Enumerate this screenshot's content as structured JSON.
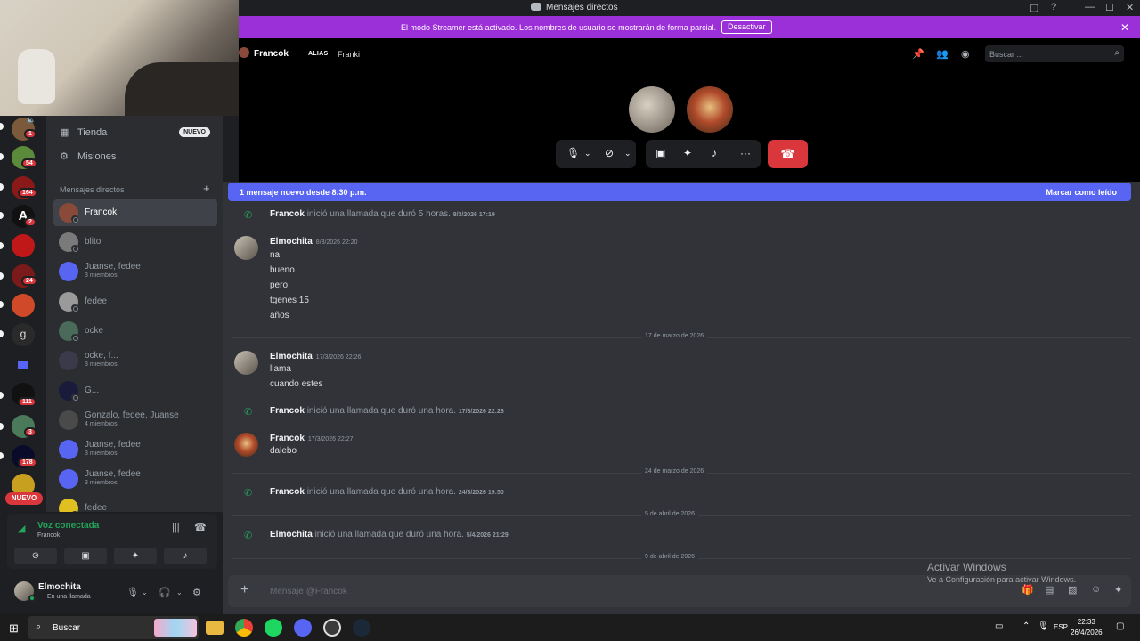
{
  "window": {
    "title": "Mensajes directos"
  },
  "banner": {
    "text": "El modo Streamer está activado. Los nombres de usuario se mostrarán de forma parcial.",
    "button": "Desactivar"
  },
  "servers": [
    {
      "badge": "1",
      "color": "#7a5a3a"
    },
    {
      "badge": "54",
      "color": "#5a8a3a"
    },
    {
      "badge": "164",
      "color": "#8a1a1a"
    },
    {
      "badge": "2",
      "color": "#111111"
    },
    {
      "badge": "",
      "color": "#c01818"
    },
    {
      "badge": "24",
      "color": "#7a1a1a"
    },
    {
      "badge": "",
      "color": "#d04a2a"
    },
    {
      "badge": "",
      "color": "#2a2a2a"
    },
    {
      "badge": "",
      "color": "#5865f2"
    },
    {
      "badge": "111",
      "color": "#111111"
    },
    {
      "badge": "3",
      "color": "#4a7a5a"
    },
    {
      "badge": "178",
      "color": "#0a0a2a"
    },
    {
      "badge": "",
      "color": "#c8a020"
    }
  ],
  "server_g_letter": "g",
  "rail_nuevo": "NUEVO",
  "nav": {
    "tienda": "Tienda",
    "tienda_tag": "NUEVO",
    "misiones": "Misiones"
  },
  "dm_header": "Mensajes directos",
  "dms": [
    {
      "name": "Francok",
      "sub": "",
      "color": "#8a4a3a"
    },
    {
      "name": "blito",
      "sub": "",
      "color": "#7a7a7a"
    },
    {
      "name": "Juanse, fedee",
      "sub": "3 miembros",
      "color": "#5865f2"
    },
    {
      "name": "fedee",
      "sub": "",
      "color": "#9a9a9a"
    },
    {
      "name": "ocke",
      "sub": "",
      "color": "#4a6a5a"
    },
    {
      "name": "ocke, f...",
      "sub": "3 miembros",
      "color": "#3a3a4a"
    },
    {
      "name": "G...",
      "sub": "",
      "color": "#1a1a3a"
    },
    {
      "name": "Gonzalo, fedee, Juanse",
      "sub": "4 miembros",
      "color": "#4a4a4a"
    },
    {
      "name": "Juanse, fedee",
      "sub": "3 miembros",
      "color": "#5865f2"
    },
    {
      "name": "Juanse, fedee",
      "sub": "3 miembros",
      "color": "#5865f2"
    },
    {
      "name": "fedee",
      "sub": "",
      "color": "#e0c020"
    }
  ],
  "voice": {
    "status": "Voz conectada",
    "channel": "Francok"
  },
  "user": {
    "name": "Elmochita",
    "status": "En una llamada"
  },
  "call": {
    "name": "Francok",
    "alias_label": "ALIAS",
    "alias_value": "Franki",
    "search_placeholder": "Buscar ..."
  },
  "newbar": {
    "left": "1 mensaje nuevo desde 8:30 p.m.",
    "right": "Marcar como leído"
  },
  "messages": {
    "sys1": {
      "who": "Francok",
      "text": "inició una llamada que duró 5 horas.",
      "ts": "8/3/2026 17:19"
    },
    "m1": {
      "who": "Elmochita",
      "ts": "8/3/2026 22:20",
      "lines": [
        "na",
        "bueno",
        "pero",
        "tgenes 15",
        "años"
      ]
    },
    "date1": "17 de marzo de 2026",
    "m2": {
      "who": "Elmochita",
      "ts": "17/3/2026 22:26",
      "lines": [
        "llama",
        "cuando estes"
      ]
    },
    "sys2": {
      "who": "Francok",
      "text": "inició una llamada que duró una hora.",
      "ts": "17/3/2026 22:26"
    },
    "m3": {
      "who": "Francok",
      "ts": "17/3/2026 22:27",
      "lines": [
        "dalebo"
      ]
    },
    "date2": "24 de marzo de 2026",
    "sys3": {
      "who": "Francok",
      "text": "inició una llamada que duró una hora.",
      "ts": "24/3/2026 19:50"
    },
    "date3": "5 de abril de 2026",
    "sys4": {
      "who": "Elmochita",
      "text": "inició una llamada que duró una hora.",
      "ts": "5/4/2026 21:29"
    },
    "date4": "9 de abril de 2026"
  },
  "composer": {
    "placeholder": "Mensaje @Francok"
  },
  "activate": {
    "line1": "Activar Windows",
    "line2": "Ve a Configuración para activar Windows."
  },
  "taskbar": {
    "search": "Buscar",
    "lang": "ESP",
    "time": "22:33",
    "date": "26/4/2026"
  },
  "colors": {
    "accent": "#5865f2",
    "streamer": "#9b30d8",
    "danger": "#da373c",
    "online": "#23a55a"
  }
}
